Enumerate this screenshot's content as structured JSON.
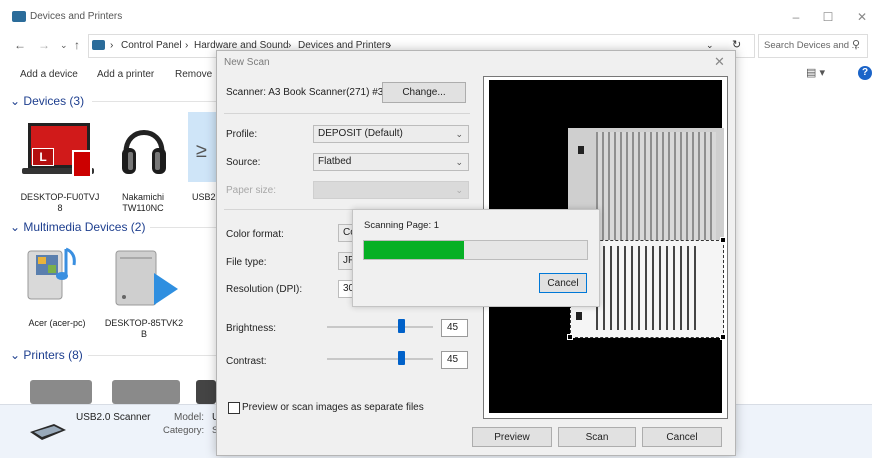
{
  "window": {
    "title": "Devices and Printers",
    "controls": [
      "–",
      "☐",
      "✕"
    ]
  },
  "nav": {
    "back": "←",
    "forward": "→",
    "recent": "⌄",
    "up": "↑",
    "chevron": "⌄",
    "refresh": "↻"
  },
  "address": {
    "crumbs": [
      "Control Panel",
      "Hardware and Sound",
      "Devices and Printers"
    ],
    "separator": "›"
  },
  "search": {
    "placeholder": "Search Devices and ...",
    "icon": "search-icon"
  },
  "commands": [
    "Add a device",
    "Add a printer",
    "Remove d"
  ],
  "groups": {
    "devices": "Devices (3)",
    "multimedia": "Multimedia Devices (2)",
    "printers": "Printers (8)"
  },
  "devices": [
    {
      "name": "DESKTOP-FU0TVJ 8",
      "icon": "laptop-icon"
    },
    {
      "name": "Nakamichi TW110NC",
      "icon": "headphones-icon"
    },
    {
      "name": "USB2",
      "icon": "scanner-icon"
    }
  ],
  "multimedia": [
    {
      "name": "Acer (acer-pc)",
      "icon": "media-server-icon"
    },
    {
      "name": "DESKTOP-85TVK2 B",
      "icon": "media-server-icon"
    }
  ],
  "details": {
    "name": "USB2.0 Scanner",
    "model_label": "Model:",
    "model_value": "U",
    "category_label": "Category:",
    "category_value": "S"
  },
  "dialog": {
    "title": "New Scan",
    "scanner_label": "Scanner: A3 Book Scanner(271) #3",
    "change_button": "Change...",
    "profile_label": "Profile:",
    "profile_value": "DEPOSIT (Default)",
    "source_label": "Source:",
    "source_value": "Flatbed",
    "paper_size_label": "Paper size:",
    "color_format_label": "Color format:",
    "color_format_value": "Co",
    "file_type_label": "File type:",
    "file_type_value": "JP",
    "resolution_label": "Resolution (DPI):",
    "resolution_value": "30",
    "brightness_label": "Brightness:",
    "brightness_value": "45",
    "contrast_label": "Contrast:",
    "contrast_value": "45",
    "separate_files_label": "Preview or scan images as separate files",
    "separate_files_checked": false,
    "preview_button": "Preview",
    "scan_button": "Scan",
    "cancel_button": "Cancel"
  },
  "progress": {
    "text": "Scanning Page: 1",
    "percent": 45,
    "cancel_button": "Cancel"
  },
  "colors": {
    "accent": "#0061c9",
    "progress": "#06b025",
    "group_heading": "#1e3f8f",
    "device_red": "#d11a1a"
  }
}
